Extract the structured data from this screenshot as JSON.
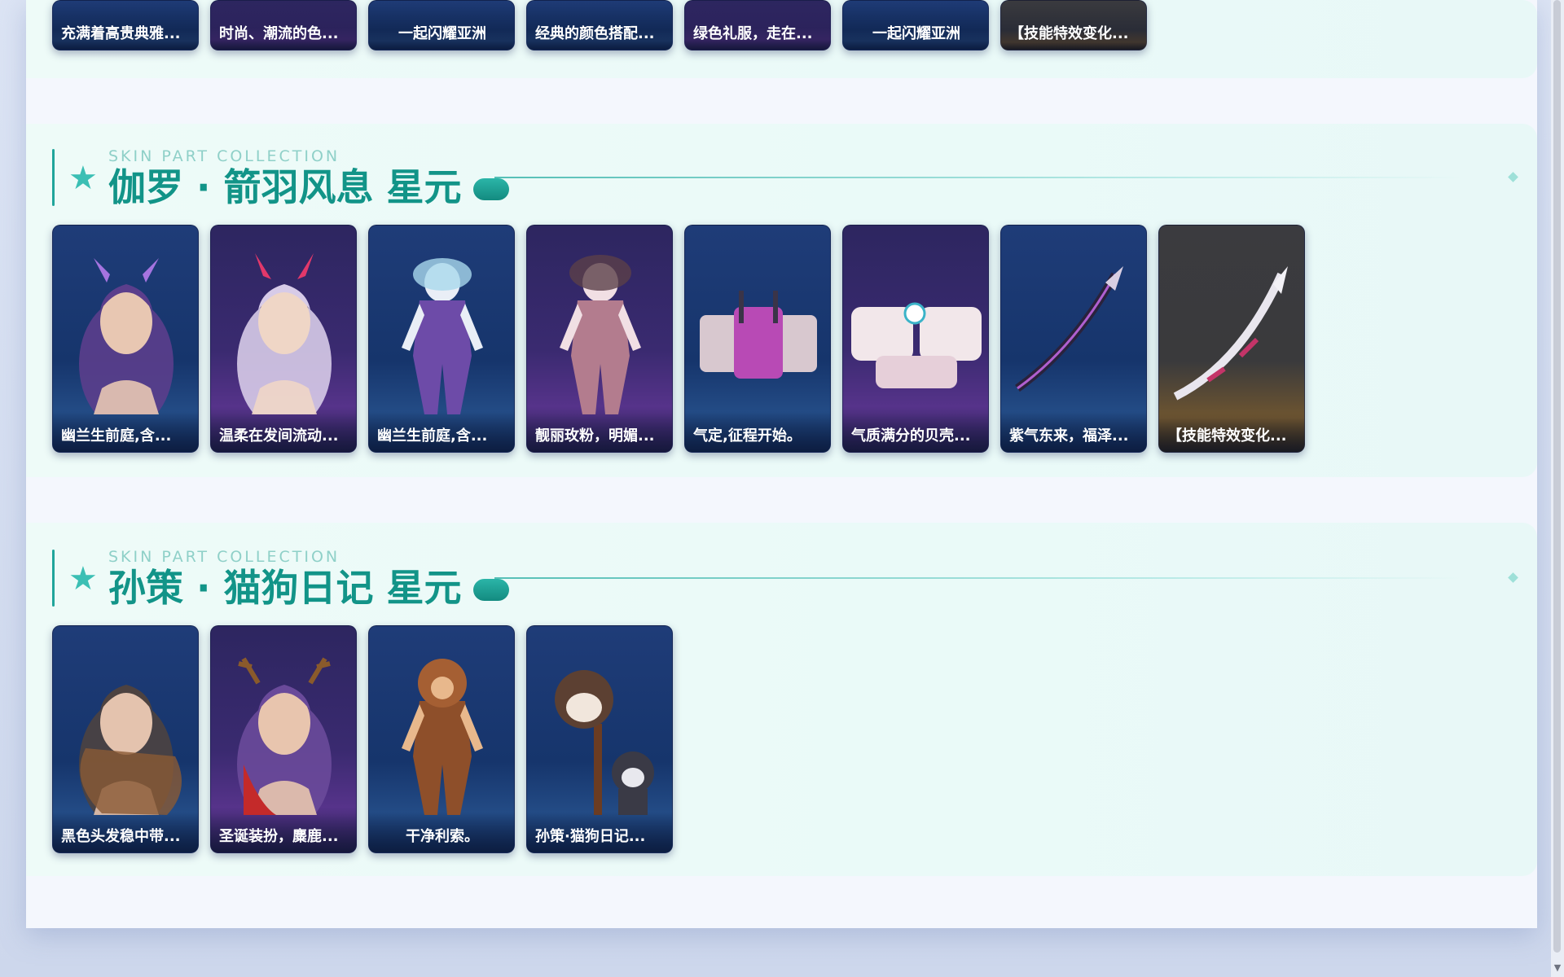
{
  "top_row": {
    "cards": [
      {
        "label": "充满着高贵典雅...",
        "theme": "blue"
      },
      {
        "label": "时尚、潮流的色...",
        "theme": "purple"
      },
      {
        "label": "一起闪耀亚洲",
        "theme": "blue",
        "center": true
      },
      {
        "label": "经典的颜色搭配...",
        "theme": "blue"
      },
      {
        "label": "绿色礼服，走在...",
        "theme": "purple"
      },
      {
        "label": "一起闪耀亚洲",
        "theme": "blue",
        "center": true
      },
      {
        "label": "【技能特效变化...",
        "theme": "gold"
      }
    ]
  },
  "sections": [
    {
      "subtitle": "SKIN PART COLLECTION",
      "title": "伽罗 · 箭羽风息 星元",
      "cards": [
        {
          "label": "幽兰生前庭,含...",
          "theme": "blue",
          "art": "purple-hair-head-icon"
        },
        {
          "label": "温柔在发间流动...",
          "theme": "purple",
          "art": "white-hair-head-icon"
        },
        {
          "label": "幽兰生前庭,含...",
          "theme": "blue",
          "art": "outfit-body-icon"
        },
        {
          "label": "靓丽玫粉，明媚...",
          "theme": "purple",
          "art": "pink-outfit-body-icon"
        },
        {
          "label": "气定,征程开始。",
          "theme": "blue",
          "art": "backpack-icon"
        },
        {
          "label": "气质满分的贝壳...",
          "theme": "purple",
          "art": "accessory-icon"
        },
        {
          "label": "紫气东来，福泽...",
          "theme": "blue",
          "art": "bow-weapon-icon"
        },
        {
          "label": "【技能特效变化...",
          "theme": "gold",
          "art": "white-bow-weapon-icon"
        }
      ]
    },
    {
      "subtitle": "SKIN PART COLLECTION",
      "title": "孙策 · 猫狗日记 星元",
      "cards": [
        {
          "label": "黑色头发稳中带...",
          "theme": "blue",
          "art": "dog-ear-head-icon"
        },
        {
          "label": "圣诞装扮，麋鹿...",
          "theme": "purple",
          "art": "reindeer-antler-head-icon"
        },
        {
          "label": "干净利索。",
          "theme": "blue",
          "center": true,
          "art": "hoodie-body-icon"
        },
        {
          "label": "孙策·猫狗日记...",
          "theme": "blue",
          "art": "dog-companion-icon"
        }
      ]
    }
  ],
  "colors": {
    "accent": "#129488",
    "subtitle": "#8fd0c8",
    "card_blue": "#1f3c78",
    "card_purple": "#2d2660",
    "card_gold": "#3b3b3f"
  }
}
